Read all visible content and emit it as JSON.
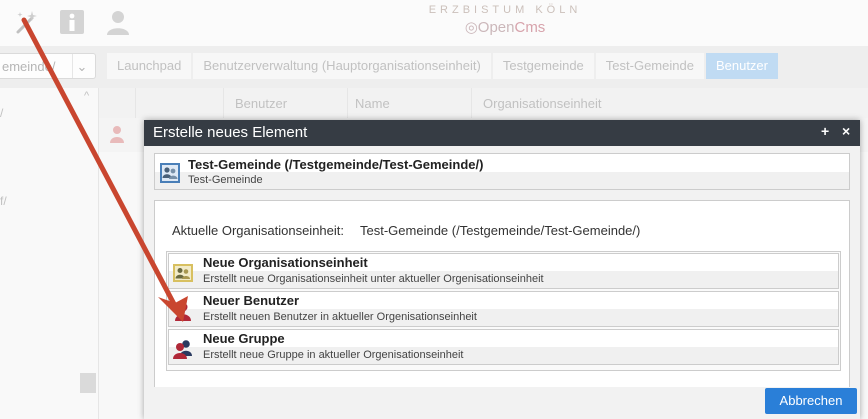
{
  "toolbar": {
    "icons": [
      "magic-wand-icon",
      "info-icon",
      "user-icon"
    ]
  },
  "logo": {
    "line1": "ERZBISTUM KÖLN",
    "line2_a": "Open",
    "line2_b": "Cms"
  },
  "ou_select": {
    "value": "emeinde/"
  },
  "breadcrumb": {
    "items": [
      "Launchpad",
      "Benutzerverwaltung (Hauptorganisationseinheit)",
      "Testgemeinde",
      "Test-Gemeinde",
      "Benutzer"
    ]
  },
  "left_tree": {
    "items": [
      "/",
      "f/"
    ]
  },
  "table": {
    "headers": [
      "Benutzer",
      "Name",
      "Organisationseinheit"
    ]
  },
  "dialog": {
    "title": "Erstelle neues Element",
    "maximize_label": "+",
    "close_label": "×",
    "context": {
      "title": "Test-Gemeinde (/Testgemeinde/Test-Gemeinde/)",
      "subtitle": "Test-Gemeinde"
    },
    "current_ou_label": "Aktuelle Organisationseinheit:",
    "current_ou_value": "Test-Gemeinde (/Testgemeinde/Test-Gemeinde/)",
    "options": [
      {
        "icon": "org-unit-icon",
        "title": "Neue Organisationseinheit",
        "description": "Erstellt neue Organisationseinheit unter aktueller Orgenisationseinheit"
      },
      {
        "icon": "user-icon",
        "title": "Neuer Benutzer",
        "description": "Erstellt neuen Benutzer in aktueller Orgenisationseinheit"
      },
      {
        "icon": "group-icon",
        "title": "Neue Gruppe",
        "description": "Erstellt neue Gruppe in aktueller Orgenisationseinheit"
      }
    ],
    "cancel_label": "Abbrechen"
  },
  "colors": {
    "dialog_header": "#363c44",
    "primary_button": "#2a7fd8",
    "annotation_arrow": "#c9462f"
  }
}
